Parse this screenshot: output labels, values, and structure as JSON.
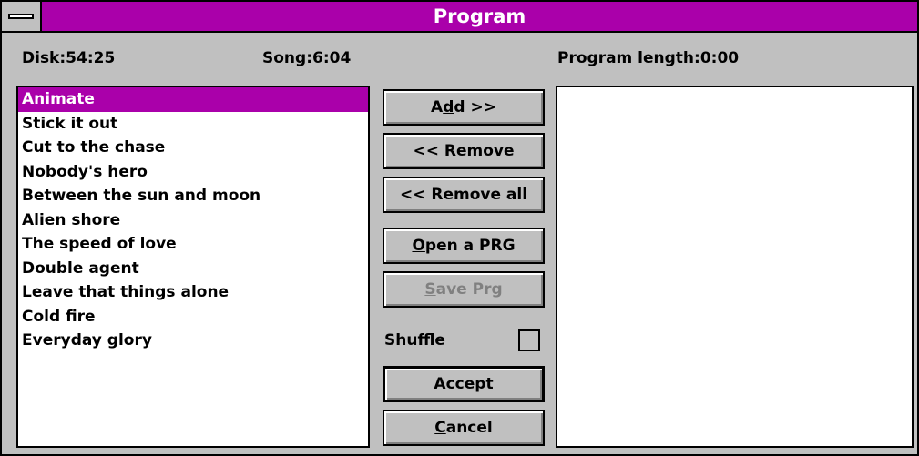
{
  "window": {
    "title": "Program"
  },
  "info": {
    "disk": "Disk:54:25",
    "song": "Song:6:04",
    "program_length": "Program length:0:00"
  },
  "songs": [
    "Animate",
    "Stick it out",
    "Cut to the chase",
    "Nobody's hero",
    "Between the sun and moon",
    "Alien shore",
    "The speed of love",
    "Double agent",
    "Leave that things alone",
    "Cold fire",
    "Everyday glory"
  ],
  "selected_song": "Animate",
  "program": [],
  "buttons": {
    "add": {
      "pre": "A",
      "key": "d",
      "post": "d >>"
    },
    "remove": {
      "pre": "<< ",
      "key": "R",
      "post": "emove"
    },
    "remove_all": {
      "pre": "<< Remove all",
      "key": "",
      "post": ""
    },
    "open_prg": {
      "pre": "",
      "key": "O",
      "post": "pen a PRG"
    },
    "save_prg": {
      "pre": "",
      "key": "S",
      "post": "ave  Prg"
    },
    "accept": {
      "pre": "",
      "key": "A",
      "post": "ccept"
    },
    "cancel": {
      "pre": "",
      "key": "C",
      "post": "ancel"
    }
  },
  "shuffle": {
    "label": "Shuffle",
    "checked": false
  },
  "colors": {
    "titlebar": "#aa00aa",
    "selection": "#aa00aa",
    "face": "#c0c0c0",
    "disabled_text": "#808080"
  }
}
